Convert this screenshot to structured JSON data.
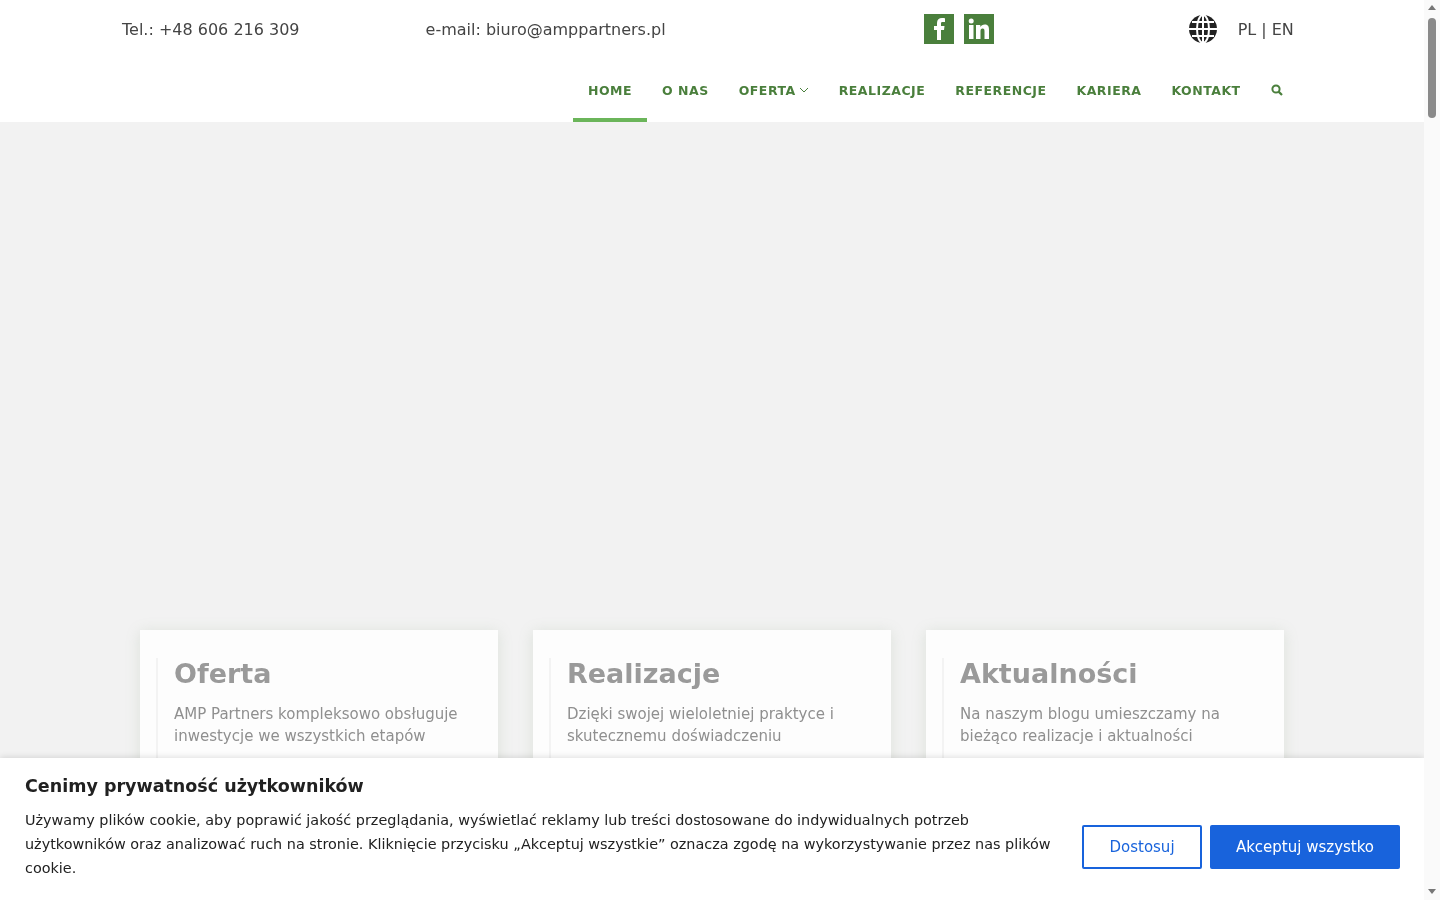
{
  "topbar": {
    "phone": "Tel.: +48 606 216 309",
    "email": "e-mail: biuro@amppartners.pl",
    "languages": "PL | EN"
  },
  "nav": [
    {
      "label": "HOME",
      "selected": true,
      "dropdown": false
    },
    {
      "label": "O NAS",
      "selected": false,
      "dropdown": false
    },
    {
      "label": "OFERTA",
      "selected": false,
      "dropdown": true
    },
    {
      "label": "REALIZACJE",
      "selected": false,
      "dropdown": false
    },
    {
      "label": "REFERENCJE",
      "selected": false,
      "dropdown": false
    },
    {
      "label": "KARIERA",
      "selected": false,
      "dropdown": false
    },
    {
      "label": "KONTAKT",
      "selected": false,
      "dropdown": false
    }
  ],
  "cards": [
    {
      "title": "Oferta",
      "text": "AMP Partners kompleksowo obsługuje inwestycje we wszystkich etapów"
    },
    {
      "title": "Realizacje",
      "text": "Dzięki swojej wieloletniej praktyce i skutecznemu doświadczeniu"
    },
    {
      "title": "Aktualności",
      "text": "Na naszym blogu umieszczamy na bieżąco realizacje i aktualności"
    }
  ],
  "cookie_banner": {
    "title": "Cenimy prywatność użytkowników",
    "text": "Używamy plików cookie, aby poprawić jakość przeglądania, wyświetlać reklamy lub treści dostosowane do indywidualnych potrzeb użytkowników oraz analizować ruch na stronie. Kliknięcie przycisku „Akceptuj wszystkie” oznacza zgodę na wykorzystywanie przez nas plików cookie.",
    "buttons": [
      {
        "label": "Dostosuj",
        "kind": "outline"
      },
      {
        "label": "Akceptuj wszystko",
        "kind": "primary"
      }
    ]
  }
}
